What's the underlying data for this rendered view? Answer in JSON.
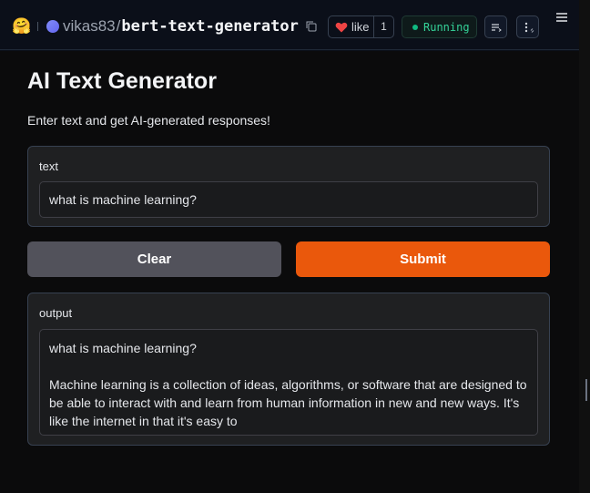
{
  "header": {
    "owner": "vikas83",
    "separator": "/",
    "repo_name": "bert-text-generator",
    "like_label": "like",
    "like_count": "1",
    "status_label": "Running"
  },
  "app": {
    "title": "AI Text Generator",
    "description": "Enter text and get AI-generated responses!",
    "input": {
      "label": "text",
      "value": "what is machine learning?"
    },
    "buttons": {
      "clear_label": "Clear",
      "submit_label": "Submit"
    },
    "output": {
      "label": "output",
      "lines": [
        "what is machine learning?",
        "",
        "Machine learning is a collection of ideas, algorithms, or software that are designed to",
        "be able to interact with and learn from human information in new and new ways. It's",
        "like the internet in that it's easy to"
      ]
    }
  },
  "colors": {
    "submit": "#ea580c",
    "clear": "#52525b",
    "running": "#10b981",
    "heart": "#ef4444"
  },
  "icons": {
    "logo": "huggingface-logo-icon",
    "copy": "copy-icon",
    "heart": "heart-icon",
    "settings": "settings-lines-icon",
    "more": "more-vertical-icon",
    "menu": "hamburger-menu-icon"
  }
}
